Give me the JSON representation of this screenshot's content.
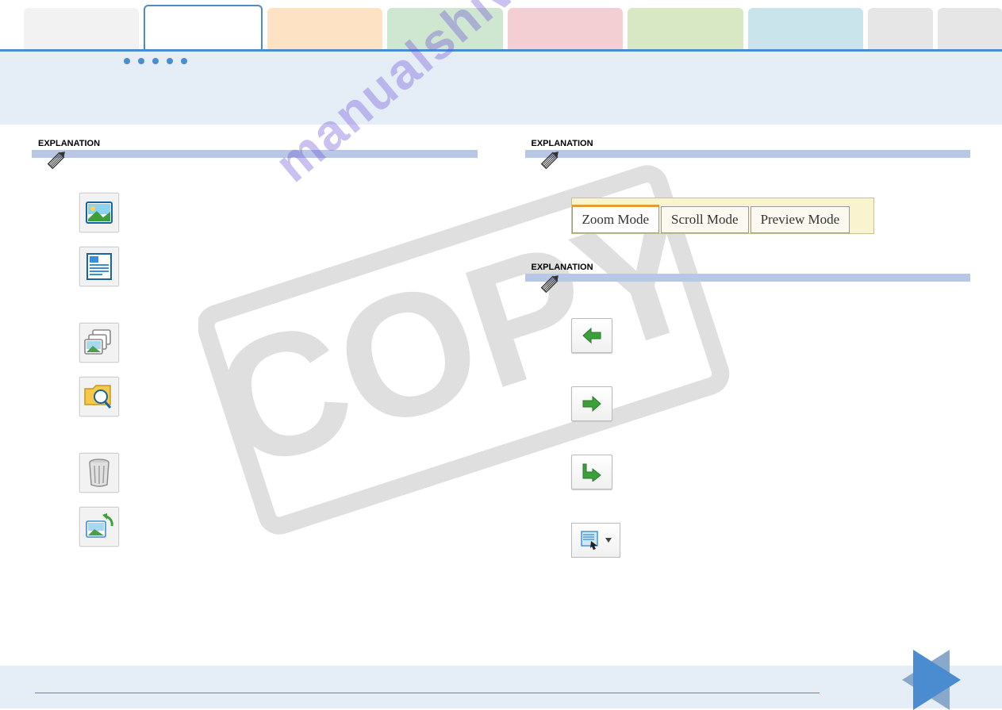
{
  "tabs": {
    "colors": [
      "#f2f2f2",
      "#ffffff",
      "#fde2c3",
      "#cfe6d1",
      "#f3cfd3",
      "#d8e8c5",
      "#c9e5eb",
      "#e6e6e6",
      "#e6e6e6"
    ],
    "active_index": 1
  },
  "left_section": {
    "label": "EXPLANATION",
    "icons": [
      "image-icon",
      "page-layout-icon",
      "slideshow-icon",
      "zoom-folder-icon",
      "trash-icon",
      "rotate-image-icon"
    ]
  },
  "right_section_top": {
    "label": "EXPLANATION"
  },
  "right_section_mid": {
    "label": "EXPLANATION"
  },
  "modes": {
    "items": [
      "Zoom Mode",
      "Scroll Mode",
      "Preview Mode"
    ],
    "active_index": 0
  },
  "arrow_buttons": [
    "arrow-left-icon",
    "arrow-right-icon",
    "arrow-up-back-icon",
    "select-tool-icon"
  ],
  "watermark_domain": "manualshive.com",
  "watermark_stamp": "COPY"
}
